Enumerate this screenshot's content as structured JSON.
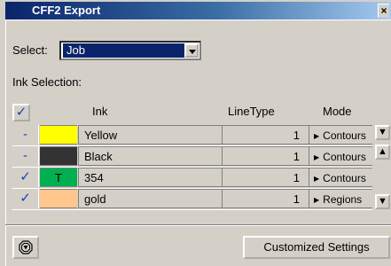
{
  "window": {
    "title": "CFF2 Export",
    "close_glyph": "×"
  },
  "select": {
    "label": "Select:",
    "value": "Job"
  },
  "ink_section": {
    "label": "Ink Selection:"
  },
  "table": {
    "headers": {
      "ink": "Ink",
      "linetype": "LineType",
      "mode": "Mode"
    },
    "rows": [
      {
        "mark": "-",
        "checked": false,
        "swatch_color": "#ffff00",
        "swatch_text": "",
        "name": "Yellow",
        "linetype": "1",
        "mode": "Contours"
      },
      {
        "mark": "-",
        "checked": false,
        "swatch_color": "#333333",
        "swatch_text": "",
        "name": "Black",
        "linetype": "1",
        "mode": "Contours"
      },
      {
        "mark": "✓",
        "checked": true,
        "swatch_color": "#00b050",
        "swatch_text": "T",
        "name": "354",
        "linetype": "1",
        "mode": "Contours"
      },
      {
        "mark": "✓",
        "checked": true,
        "swatch_color": "#ffc78e",
        "swatch_text": "",
        "name": "gold",
        "linetype": "1",
        "mode": "Regions"
      }
    ]
  },
  "buttons": {
    "customized_settings": "Customized Settings",
    "left_icon": "stop-octagon-icon"
  },
  "colors": {
    "titlebar": "#0a246a",
    "selection": "#0a246a",
    "check": "#1b3fbf",
    "face": "#d4d0c8"
  }
}
